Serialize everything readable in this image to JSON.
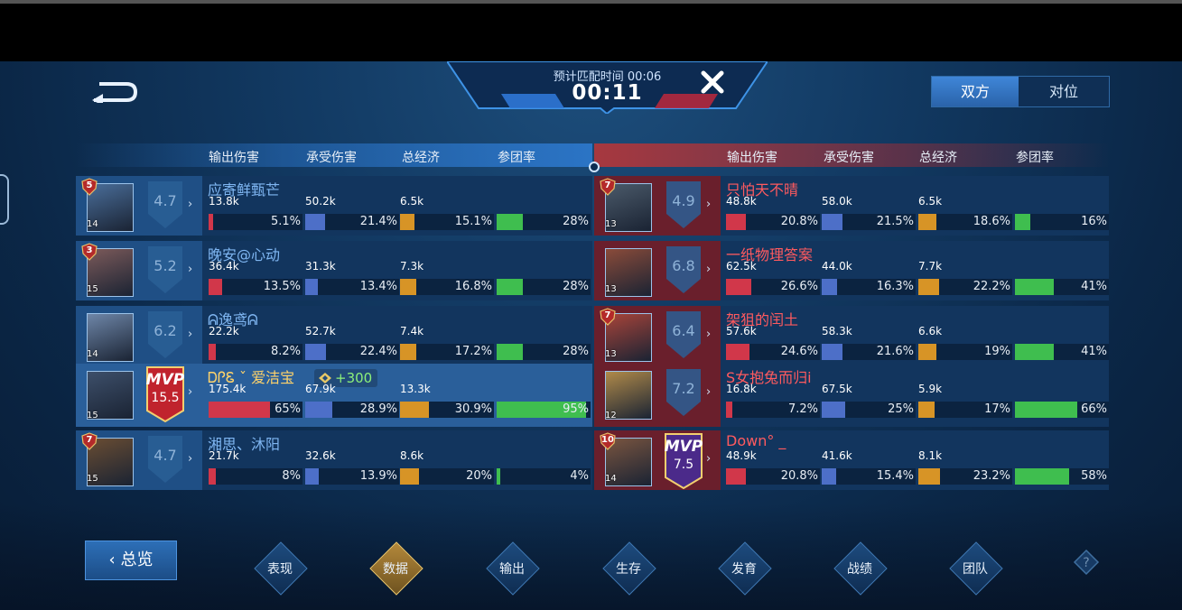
{
  "header": {
    "timer_label": "预计匹配时间 00:06",
    "timer_value": "00:11",
    "view_toggle": [
      {
        "label": "双方",
        "active": true
      },
      {
        "label": "对位",
        "active": false
      }
    ]
  },
  "columns": [
    "输出伤害",
    "承受伤害",
    "总经济",
    "参团率"
  ],
  "left_team": [
    {
      "name": "应寄鲜甄芒",
      "rank": "5",
      "level": "14",
      "score": "4.7",
      "mvp": false,
      "damage": "13.8k",
      "damage_pct": "5.1%",
      "damage_frac": 0.051,
      "taken": "50.2k",
      "taken_pct": "21.4%",
      "taken_frac": 0.214,
      "gold": "6.5k",
      "gold_pct": "15.1%",
      "gold_frac": 0.151,
      "part_pct": "28%",
      "part_frac": 0.28
    },
    {
      "name": "晚安@心动",
      "rank": "3",
      "level": "15",
      "score": "5.2",
      "mvp": false,
      "damage": "36.4k",
      "damage_pct": "13.5%",
      "damage_frac": 0.135,
      "taken": "31.3k",
      "taken_pct": "13.4%",
      "taken_frac": 0.134,
      "gold": "7.3k",
      "gold_pct": "16.8%",
      "gold_frac": 0.168,
      "part_pct": "28%",
      "part_frac": 0.28
    },
    {
      "name": "ᕱ逸鸢ᕱ",
      "rank": "",
      "level": "14",
      "score": "6.2",
      "mvp": false,
      "damage": "22.2k",
      "damage_pct": "8.2%",
      "damage_frac": 0.082,
      "taken": "52.7k",
      "taken_pct": "22.4%",
      "taken_frac": 0.224,
      "gold": "7.4k",
      "gold_pct": "17.2%",
      "gold_frac": 0.172,
      "part_pct": "28%",
      "part_frac": 0.28
    },
    {
      "name": "ᎠᎵᏋ ˇ 爱洁宝",
      "rank": "",
      "level": "15",
      "score": "15.5",
      "mvp": true,
      "mvp_label": "MVP",
      "bonus": "+300",
      "damage": "175.4k",
      "damage_pct": "65%",
      "damage_frac": 0.65,
      "taken": "67.9k",
      "taken_pct": "28.9%",
      "taken_frac": 0.289,
      "gold": "13.3k",
      "gold_pct": "30.9%",
      "gold_frac": 0.309,
      "part_pct": "95%",
      "part_frac": 0.95
    },
    {
      "name": "湘思、沐阳",
      "rank": "7",
      "level": "15",
      "score": "4.7",
      "mvp": false,
      "damage": "21.7k",
      "damage_pct": "8%",
      "damage_frac": 0.08,
      "taken": "32.6k",
      "taken_pct": "13.9%",
      "taken_frac": 0.139,
      "gold": "8.6k",
      "gold_pct": "20%",
      "gold_frac": 0.2,
      "part_pct": "4%",
      "part_frac": 0.04
    }
  ],
  "right_team": [
    {
      "name": "只怕天不晴",
      "rank": "7",
      "level": "13",
      "score": "4.9",
      "mvp": false,
      "damage": "48.8k",
      "damage_pct": "20.8%",
      "damage_frac": 0.208,
      "taken": "58.0k",
      "taken_pct": "21.5%",
      "taken_frac": 0.215,
      "gold": "6.5k",
      "gold_pct": "18.6%",
      "gold_frac": 0.186,
      "part_pct": "16%",
      "part_frac": 0.16
    },
    {
      "name": "一纸物理答案",
      "rank": "",
      "level": "13",
      "score": "6.8",
      "mvp": false,
      "damage": "62.5k",
      "damage_pct": "26.6%",
      "damage_frac": 0.266,
      "taken": "44.0k",
      "taken_pct": "16.3%",
      "taken_frac": 0.163,
      "gold": "7.7k",
      "gold_pct": "22.2%",
      "gold_frac": 0.222,
      "part_pct": "41%",
      "part_frac": 0.41
    },
    {
      "name": "架狙的闰土",
      "rank": "7",
      "level": "13",
      "score": "6.4",
      "mvp": false,
      "damage": "57.6k",
      "damage_pct": "24.6%",
      "damage_frac": 0.246,
      "taken": "58.3k",
      "taken_pct": "21.6%",
      "taken_frac": 0.216,
      "gold": "6.6k",
      "gold_pct": "19%",
      "gold_frac": 0.19,
      "part_pct": "41%",
      "part_frac": 0.41
    },
    {
      "name": "S女抱兔而归i",
      "rank": "",
      "level": "12",
      "score": "7.2",
      "mvp": false,
      "damage": "16.8k",
      "damage_pct": "7.2%",
      "damage_frac": 0.072,
      "taken": "67.5k",
      "taken_pct": "25%",
      "taken_frac": 0.25,
      "gold": "5.9k",
      "gold_pct": "17%",
      "gold_frac": 0.17,
      "part_pct": "66%",
      "part_frac": 0.66
    },
    {
      "name": "Down° _",
      "rank": "10",
      "level": "14",
      "score": "7.5",
      "mvp": true,
      "mvp_label": "MVP",
      "damage": "48.9k",
      "damage_pct": "20.8%",
      "damage_frac": 0.208,
      "taken": "41.6k",
      "taken_pct": "15.4%",
      "taken_frac": 0.154,
      "gold": "8.1k",
      "gold_pct": "23.2%",
      "gold_frac": 0.232,
      "part_pct": "58%",
      "part_frac": 0.58
    }
  ],
  "bottom": {
    "overview_label": "总览",
    "tabs": [
      {
        "label": "表现",
        "active": false
      },
      {
        "label": "数据",
        "active": true
      },
      {
        "label": "输出",
        "active": false
      },
      {
        "label": "生存",
        "active": false
      },
      {
        "label": "发育",
        "active": false
      },
      {
        "label": "战绩",
        "active": false
      },
      {
        "label": "团队",
        "active": false
      }
    ]
  },
  "colors": {
    "damage": "#d1374a",
    "taken": "#4d6fc8",
    "gold": "#d79426",
    "participation": "#3fbe4f",
    "left_accent": "#2b74c5",
    "right_accent": "#a7383f"
  },
  "icons": [
    "back-arrow-icon",
    "close-icon",
    "rank-shield-icon",
    "score-shield-icon",
    "mvp-badge-icon",
    "chevron-right-icon",
    "bonus-icon",
    "help-icon"
  ]
}
